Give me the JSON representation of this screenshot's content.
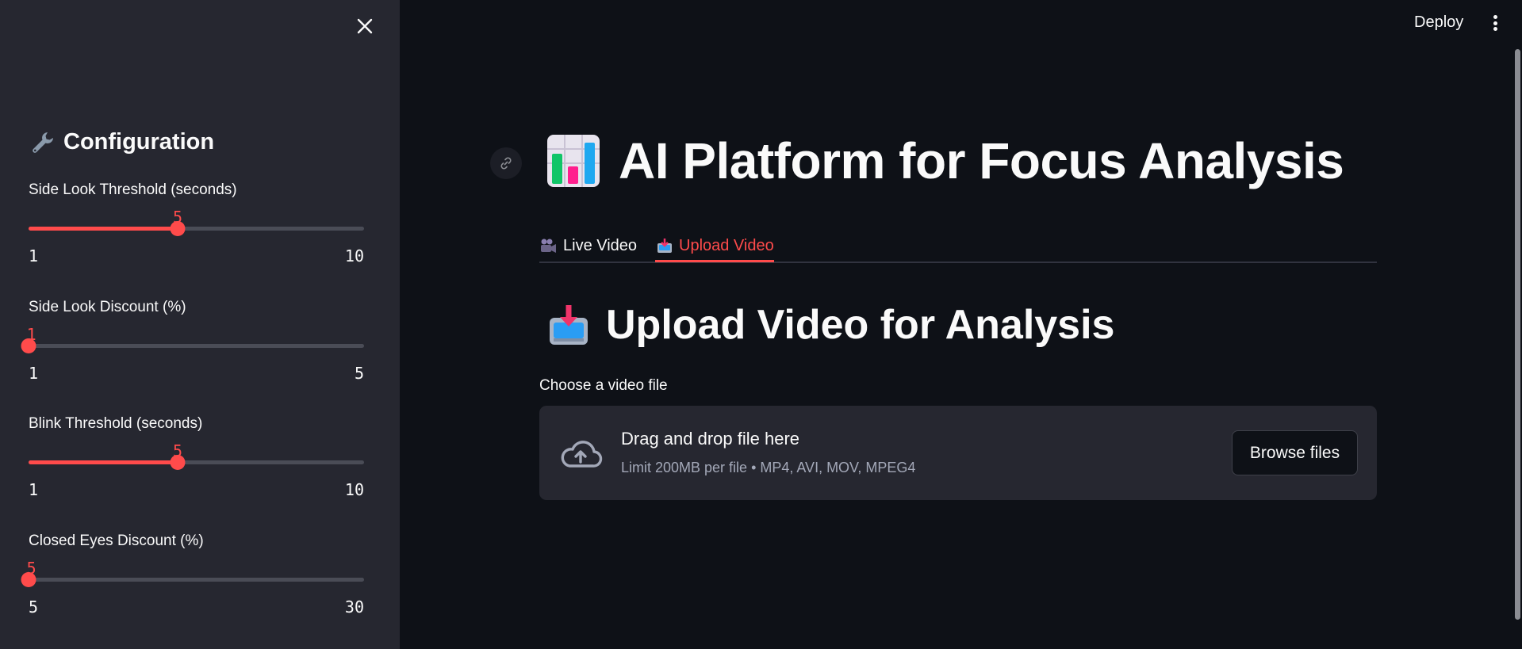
{
  "sidebar": {
    "title": "Configuration",
    "title_icon": "wrench-icon",
    "sliders": [
      {
        "label": "Side Look Threshold (seconds)",
        "value": "5",
        "min": "1",
        "max": "10",
        "value_num": 5,
        "min_num": 1,
        "max_num": 10
      },
      {
        "label": "Side Look Discount (%)",
        "value": "1",
        "min": "1",
        "max": "5",
        "value_num": 1,
        "min_num": 1,
        "max_num": 5
      },
      {
        "label": "Blink Threshold (seconds)",
        "value": "5",
        "min": "1",
        "max": "10",
        "value_num": 5,
        "min_num": 1,
        "max_num": 10
      },
      {
        "label": "Closed Eyes Discount (%)",
        "value": "5",
        "min": "5",
        "max": "30",
        "value_num": 5,
        "min_num": 5,
        "max_num": 30
      }
    ]
  },
  "header": {
    "deploy_label": "Deploy"
  },
  "main": {
    "title": "AI Platform for Focus Analysis",
    "title_icon": "bar-chart-icon",
    "tabs": [
      {
        "label": "Live Video",
        "icon": "video-camera-icon",
        "active": false
      },
      {
        "label": "Upload Video",
        "icon": "inbox-tray-icon",
        "active": true
      }
    ],
    "section_title": "Upload Video for Analysis",
    "section_icon": "inbox-tray-icon",
    "uploader": {
      "label": "Choose a video file",
      "drag_text": "Drag and drop file here",
      "limit_text": "Limit 200MB per file • MP4, AVI, MOV, MPEG4",
      "browse_label": "Browse files"
    }
  },
  "colors": {
    "accent": "#ff4b4b",
    "background": "#0e1117",
    "sidebar": "#262730"
  }
}
